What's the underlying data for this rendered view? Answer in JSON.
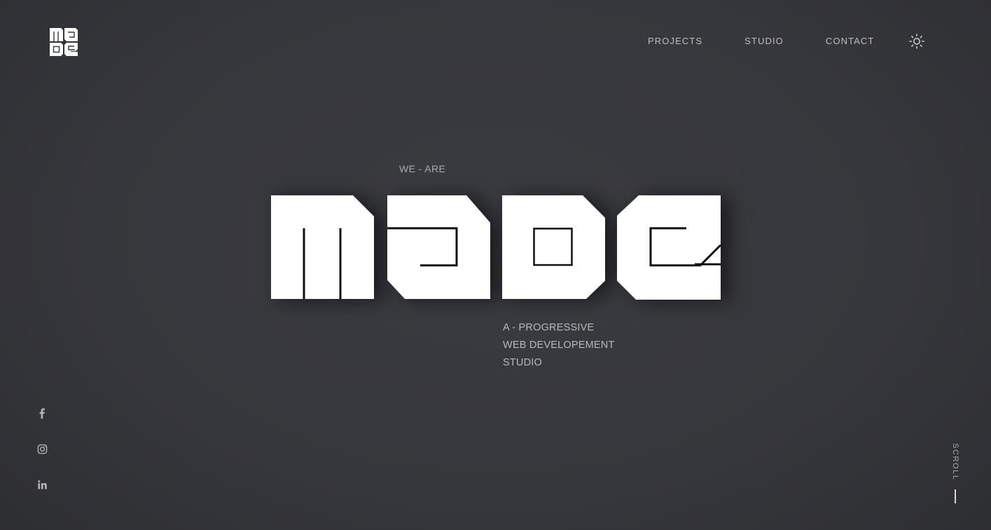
{
  "brand": {
    "logo_icon": "made-logo-mark",
    "wordmark_icon": "made-wordmark"
  },
  "nav": {
    "items": [
      {
        "label": "PROJECTS"
      },
      {
        "label": "STUDIO"
      },
      {
        "label": "CONTACT"
      }
    ],
    "theme_toggle_icon": "sun-icon"
  },
  "hero": {
    "pre_title": "WE - ARE",
    "tagline_lines": [
      "A - PROGRESSIVE",
      "WEB DEVELOPEMENT",
      "STUDIO"
    ]
  },
  "social": {
    "items": [
      {
        "icon": "facebook-icon"
      },
      {
        "icon": "instagram-icon"
      },
      {
        "icon": "linkedin-icon"
      }
    ]
  },
  "scroll": {
    "label": "SCROLL"
  },
  "colors": {
    "background": "#36373c",
    "text": "#bfbfc3",
    "wordmark": "#ffffff"
  }
}
